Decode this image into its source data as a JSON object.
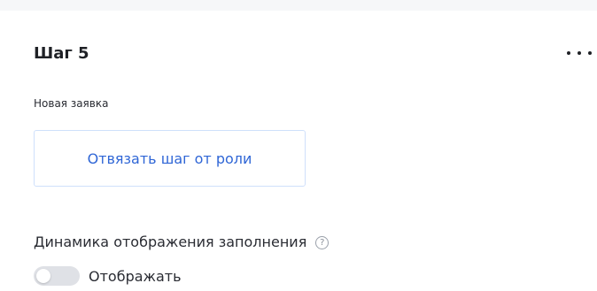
{
  "step": {
    "title": "Шаг 5",
    "subtitle": "Новая заявка",
    "unbind_button_label": "Отвязать шаг от роли"
  },
  "display_dynamics": {
    "label": "Динамика отображения заполнения",
    "help_icon_glyph": "?",
    "toggle_label": "Отображать",
    "toggle_on": false
  },
  "colors": {
    "accent": "#2f66d6",
    "button_border": "#cfe0fb",
    "toggle_off_bg": "#dfe1e6"
  },
  "icons": {
    "more": "more-horizontal-icon",
    "help": "question-circle-icon"
  }
}
